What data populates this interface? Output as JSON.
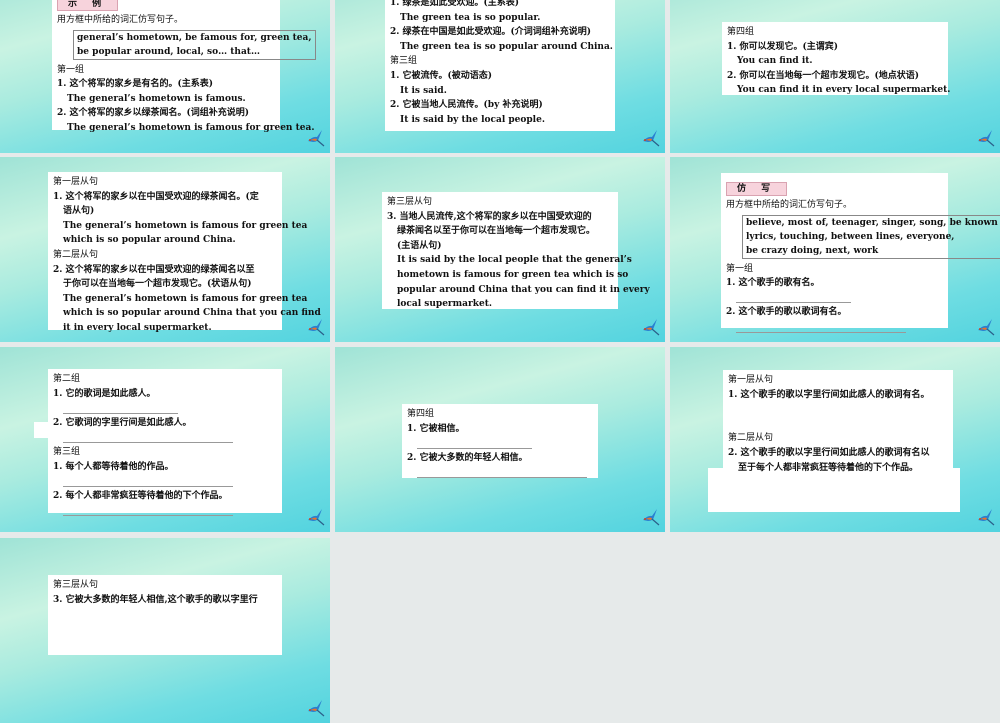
{
  "slides": [
    {
      "tag": "示 例",
      "lines": [
        {
          "t": "h",
          "v": "用方框中所给的词汇仿写句子。"
        },
        {
          "t": "words",
          "v": [
            "general’s hometown, be famous for, green tea,",
            "be popular around, local, so… that…"
          ]
        },
        {
          "t": "h",
          "v": "第一组"
        },
        {
          "t": "cn",
          "v": "1. 这个将军的家乡是有名的。(主系表)"
        },
        {
          "t": "en",
          "v": "The general’s hometown is famous."
        },
        {
          "t": "cn",
          "v": "2. 这个将军的家乡以绿茶闻名。(词组补充说明)"
        },
        {
          "t": "en",
          "v": "The general’s hometown is famous for green tea."
        }
      ]
    },
    {
      "lines": [
        {
          "t": "cn",
          "v": "1. 绿茶是如此受欢迎。(主系表)"
        },
        {
          "t": "en",
          "v": "The green tea is so popular."
        },
        {
          "t": "cn",
          "v": "2. 绿茶在中国是如此受欢迎。(介词词组补充说明)"
        },
        {
          "t": "en",
          "v": "The green tea is so popular around China."
        },
        {
          "t": "h",
          "v": "第三组"
        },
        {
          "t": "cn",
          "v": "1. 它被流传。(被动语态)"
        },
        {
          "t": "en",
          "v": "It is said."
        },
        {
          "t": "cn",
          "v": "2. 它被当地人民流传。(by 补充说明)"
        },
        {
          "t": "en",
          "v": "It is said by the local people."
        }
      ]
    },
    {
      "lines": [
        {
          "t": "h",
          "v": "第四组"
        },
        {
          "t": "cn",
          "v": "1. 你可以发现它。(主谓宾)"
        },
        {
          "t": "en",
          "v": "You can find it."
        },
        {
          "t": "cn",
          "v": "2. 你可以在当地每一个超市发现它。(地点状语)"
        },
        {
          "t": "en",
          "v": "You can find it in every local supermarket."
        }
      ]
    },
    {
      "lines": [
        {
          "t": "h",
          "v": "第一层从句"
        },
        {
          "t": "cn",
          "v": "1. 这个将军的家乡以在中国受欢迎的绿茶闻名。(定"
        },
        {
          "t": "cn2",
          "v": "语从句)"
        },
        {
          "t": "en",
          "v": "The general’s hometown is famous for green tea"
        },
        {
          "t": "en",
          "v": "which is so popular around China."
        },
        {
          "t": "h",
          "v": "第二层从句"
        },
        {
          "t": "cn",
          "v": "2. 这个将军的家乡以在中国受欢迎的绿茶闻名以至"
        },
        {
          "t": "cn2",
          "v": "于你可以在当地每一个超市发现它。(状语从句)"
        },
        {
          "t": "en",
          "v": "The general’s hometown is famous for green tea"
        },
        {
          "t": "en",
          "v": "which is so popular around China that you can find"
        },
        {
          "t": "en",
          "v": "it in every local supermarket."
        }
      ]
    },
    {
      "lines": [
        {
          "t": "h",
          "v": "第三层从句"
        },
        {
          "t": "cn",
          "v": "3. 当地人民流传,这个将军的家乡以在中国受欢迎的"
        },
        {
          "t": "cn2",
          "v": "绿茶闻名以至于你可以在当地每一个超市发现它。"
        },
        {
          "t": "cn2",
          "v": "(主语从句)"
        },
        {
          "t": "en",
          "v": "It is said by the local people that the general’s"
        },
        {
          "t": "en",
          "v": "hometown is famous for green tea which is so"
        },
        {
          "t": "en",
          "v": "popular around China that you can find it in every"
        },
        {
          "t": "en",
          "v": "local supermarket."
        }
      ]
    },
    {
      "tag": "仿 写",
      "lines": [
        {
          "t": "h",
          "v": "用方框中所给的词汇仿写句子。"
        },
        {
          "t": "words",
          "v": [
            "believe, most of, teenager, singer, song, be known for,",
            "lyrics, touching, between lines, everyone,",
            "be crazy doing, next, work"
          ]
        },
        {
          "t": "h",
          "v": "第一组"
        },
        {
          "t": "cn",
          "v": "1. 这个歌手的歌有名。"
        },
        {
          "t": "blank-short",
          "v": ""
        },
        {
          "t": "cn",
          "v": "2. 这个歌手的歌以歌词有名。"
        },
        {
          "t": "blank-long",
          "v": ""
        }
      ]
    },
    {
      "lines": [
        {
          "t": "h",
          "v": "第二组"
        },
        {
          "t": "cn",
          "v": "1. 它的歌词是如此感人。"
        },
        {
          "t": "blank-short",
          "v": ""
        },
        {
          "t": "cn",
          "v": "2. 它歌词的字里行间是如此感人。"
        },
        {
          "t": "blank-long",
          "v": ""
        },
        {
          "t": "h",
          "v": "第三组"
        },
        {
          "t": "cn",
          "v": "1. 每个人都等待着他的作品。"
        },
        {
          "t": "blank-long",
          "v": ""
        },
        {
          "t": "cn",
          "v": "2. 每个人都非常疯狂等待着他的下个作品。"
        },
        {
          "t": "blank-long",
          "v": ""
        }
      ]
    },
    {
      "lines": [
        {
          "t": "h",
          "v": "第四组"
        },
        {
          "t": "cn",
          "v": "1. 它被相信。"
        },
        {
          "t": "blank-short",
          "v": ""
        },
        {
          "t": "cn",
          "v": "2. 它被大多数的年轻人相信。"
        },
        {
          "t": "blank-long",
          "v": ""
        }
      ]
    },
    {
      "lines": [
        {
          "t": "h",
          "v": "第一层从句"
        },
        {
          "t": "cn",
          "v": "1. 这个歌手的歌以字里行间如此感人的歌词有名。"
        },
        {
          "t": "gap",
          "v": ""
        },
        {
          "t": "gap",
          "v": ""
        },
        {
          "t": "h",
          "v": "第二层从句"
        },
        {
          "t": "cn",
          "v": "2. 这个歌手的歌以字里行间如此感人的歌词有名以"
        },
        {
          "t": "cn2",
          "v": "至于每个人都非常疯狂等待着他的下个作品。"
        }
      ]
    },
    {
      "lines": [
        {
          "t": "h",
          "v": "第三层从句"
        },
        {
          "t": "cn",
          "v": "3. 它被大多数的年轻人相信,这个歌手的歌以字里行"
        }
      ]
    }
  ],
  "icons": {
    "slide_corner": "parrot-icon"
  }
}
